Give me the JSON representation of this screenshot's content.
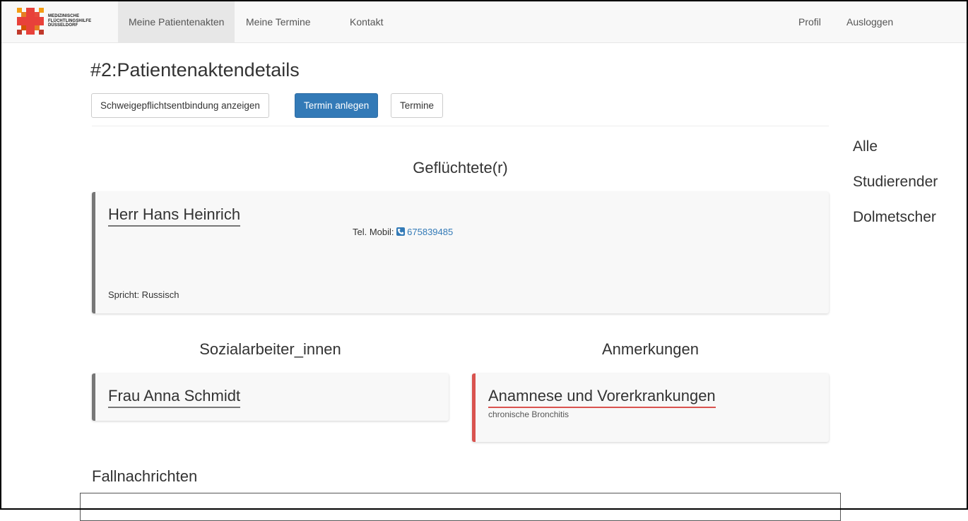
{
  "nav": {
    "logo_lines": [
      "MEDIZINISCHE",
      "FLÜCHTLINGSHILFE",
      "DÜSSELDORF"
    ],
    "items": [
      {
        "label": "Meine Patientenakten",
        "active": true
      },
      {
        "label": "Meine Termine",
        "active": false
      },
      {
        "label": "Kontakt",
        "active": false
      }
    ],
    "right": [
      {
        "label": "Profil"
      },
      {
        "label": "Ausloggen"
      }
    ]
  },
  "page": {
    "title": "#2:Patientenaktendetails",
    "buttons": [
      {
        "label": "Schweigepflichtsentbindung anzeigen",
        "style": "default"
      },
      {
        "label": "Termin anlegen",
        "style": "primary"
      },
      {
        "label": "Termine",
        "style": "default"
      }
    ]
  },
  "refugee": {
    "heading": "Geflüchtete(r)",
    "name": "Herr Hans Heinrich",
    "phone_label": "Tel. Mobil:",
    "phone_number": "675839485",
    "language": "Spricht: Russisch"
  },
  "social": {
    "heading": "Sozialarbeiter_innen",
    "name": "Frau Anna Schmidt"
  },
  "notes": {
    "heading": "Anmerkungen",
    "title": "Anamnese und Vorerkrankungen",
    "text": "chronische Bronchitis"
  },
  "sidebar": {
    "filters": [
      "Alle",
      "Studierender",
      "Dolmetscher"
    ]
  },
  "messages": {
    "heading": "Fallnachrichten"
  },
  "colors": {
    "primary": "#337ab7",
    "danger": "#d9534f",
    "navbar_bg": "#f8f8f8",
    "card_bg": "#f8f8f8"
  }
}
